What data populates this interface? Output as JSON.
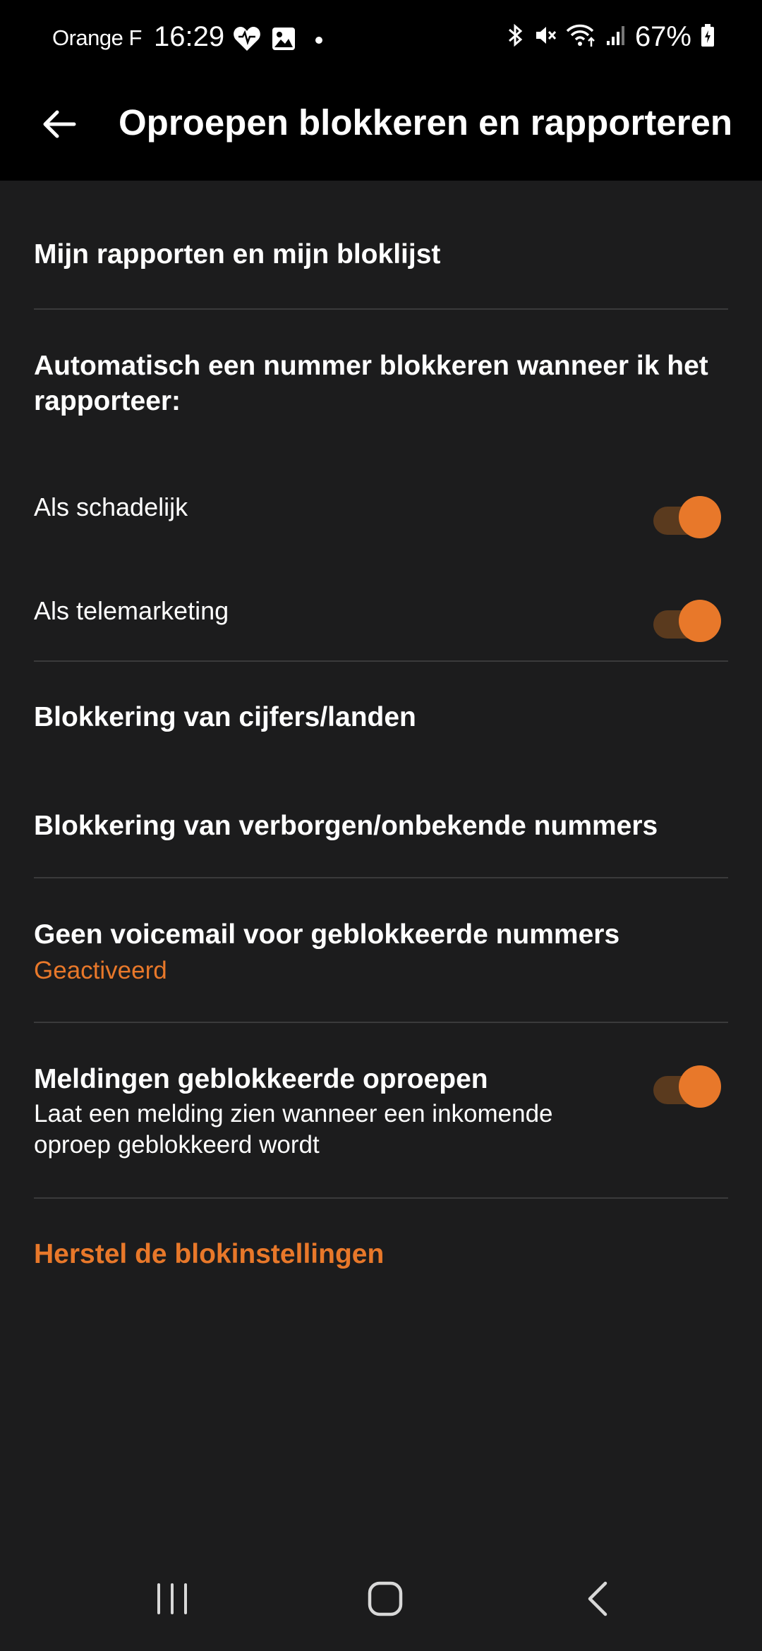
{
  "status_bar": {
    "carrier": "Orange F",
    "time": "16:29",
    "battery": "67%",
    "left_icons": [
      "heart-icon",
      "gallery-icon",
      "dot-icon"
    ],
    "right_icons": [
      "bluetooth-icon",
      "mute-icon",
      "wifi-icon",
      "signal-icon",
      "battery-icon"
    ]
  },
  "app_bar": {
    "title": "Oproepen blokkeren en rapporteren",
    "back_icon": "arrow-left-icon"
  },
  "settings": {
    "my_reports": "Mijn rapporten en mijn bloklijst",
    "auto_block_header": "Automatisch een nummer blokkeren wanneer ik het rapporteer:",
    "as_harmful": {
      "label": "Als schadelijk",
      "enabled": true
    },
    "as_telemarketing": {
      "label": "Als telemarketing",
      "enabled": true
    },
    "digits_countries": "Blokkering van cijfers/landen",
    "hidden_unknown": "Blokkering van verborgen/onbekende nummers",
    "no_voicemail": {
      "title": "Geen voicemail voor geblokkeerde nummers",
      "status": "Geactiveerd"
    },
    "notifications": {
      "title": "Meldingen geblokkeerde oproepen",
      "description": "Laat een melding zien wanneer een inkomende oproep geblokkeerd wordt",
      "enabled": true
    },
    "reset": "Herstel de blokinstellingen"
  },
  "colors": {
    "accent": "#e8782a",
    "toggle_track": "#5a3a1e",
    "background": "#1c1c1d",
    "bar_background": "#000000",
    "divider": "#3a3a3b"
  },
  "nav_bar": {
    "icons": [
      "recent-apps-icon",
      "home-icon",
      "back-icon"
    ]
  }
}
